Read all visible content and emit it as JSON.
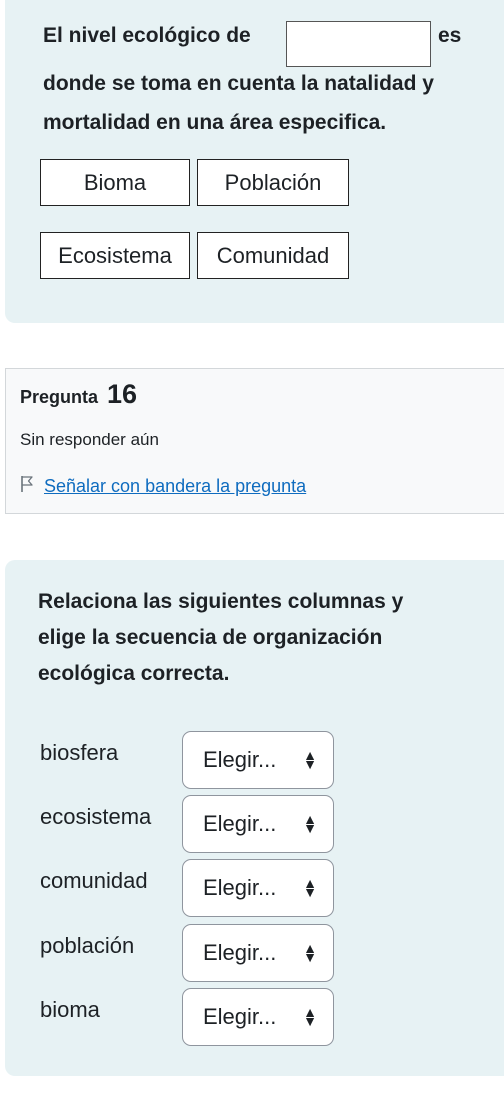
{
  "question15": {
    "text_part1": "El nivel ecológico de",
    "text_part2": "es",
    "text_line2": "donde se toma en cuenta la natalidad y",
    "text_line3": "mortalidad en una área especifica.",
    "choices": [
      "Bioma",
      "Población",
      "Ecosistema",
      "Comunidad"
    ]
  },
  "question16_info": {
    "label": "Pregunta",
    "number": "16",
    "status": "Sin responder aún",
    "flag_link": "Señalar con bandera la pregunta",
    "flag_icon": "flag-outline-icon"
  },
  "question16": {
    "line1": "Relaciona las siguientes columnas y",
    "line2": "elige la secuencia de organización",
    "line3": "ecológica correcta.",
    "rows": [
      {
        "label": "biosfera",
        "select": "Elegir..."
      },
      {
        "label": "ecosistema",
        "select": "Elegir..."
      },
      {
        "label": "comunidad",
        "select": "Elegir..."
      },
      {
        "label": "población",
        "select": "Elegir..."
      },
      {
        "label": "bioma",
        "select": "Elegir..."
      }
    ],
    "select_icon": "updown-chevron-icon"
  },
  "colors": {
    "panel_bg": "#e7f2f4",
    "info_bg": "#f8f9fa",
    "link": "#0f6cbf"
  }
}
